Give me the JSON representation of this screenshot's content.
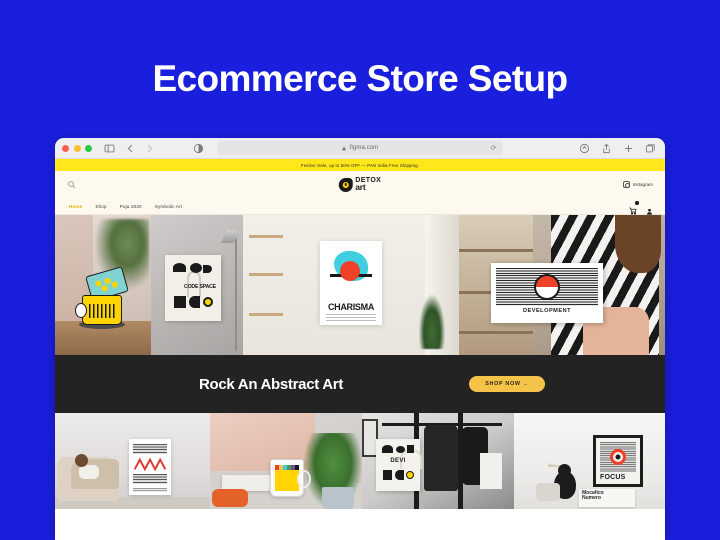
{
  "page": {
    "title": "Ecommerce Store Setup",
    "background_color": "#1a1fde",
    "title_color": "#ffffff"
  },
  "browser": {
    "name": "safari-window",
    "traffic_lights": [
      "close",
      "minimize",
      "maximize"
    ],
    "sidebar_icon": "sidebar-toggle-icon",
    "back_icon": "chevron-left-icon",
    "forward_icon": "chevron-right-icon",
    "contrast_icon": "contrast-icon",
    "address": {
      "lock_icon": "lock-icon",
      "url": "figma.com",
      "reload_icon": "reload-icon"
    },
    "right_icons": [
      "shield-icon",
      "share-icon",
      "new-tab-icon",
      "tabs-overview-icon"
    ]
  },
  "site": {
    "promo_banner": {
      "text": "Festive Sale, up to 50% OFF — PAN India Free Shipping.",
      "background": "#ffe81a"
    },
    "header": {
      "search_icon": "search-icon",
      "logo": {
        "top_word": "DETOX",
        "bottom_word": "art",
        "mark": "eye-logo-icon"
      },
      "instagram": {
        "icon": "instagram-icon",
        "label": "Instagram"
      }
    },
    "nav": {
      "items": [
        {
          "label": "Home",
          "active": true
        },
        {
          "label": "Shop",
          "active": false
        },
        {
          "label": "Puja 2020",
          "active": false
        },
        {
          "label": "Symbolic Art",
          "active": false
        }
      ],
      "cart_icon": "shopping-cart-icon",
      "account_icon": "user-account-icon",
      "active_color": "#e8b400"
    },
    "hero": {
      "cells": [
        {
          "name": "stacked-mugs-photo",
          "caption": ""
        },
        {
          "name": "code-space-tote-photo",
          "product_text": "CODE SPACE"
        },
        {
          "name": "charisma-poster-photo",
          "product_text": "CHARISMA"
        },
        {
          "name": "development-poster-photo",
          "product_text": "DEVELOPMENT"
        }
      ]
    },
    "cta": {
      "title": "Rock An Abstract Art",
      "button_label": "SHOP NOW  →",
      "background": "#232323",
      "button_color": "#f6c34a"
    },
    "bottom": {
      "cells": [
        {
          "name": "living-room-art-photo",
          "product_text": ""
        },
        {
          "name": "colorful-mug-photo",
          "product_text": ""
        },
        {
          "name": "devi-tote-photo",
          "product_text": "DEVI"
        },
        {
          "name": "focus-poster-photo",
          "product_text": "FOCUS",
          "book_line1": "Mocafico",
          "book_line2": "Numero"
        }
      ]
    }
  }
}
